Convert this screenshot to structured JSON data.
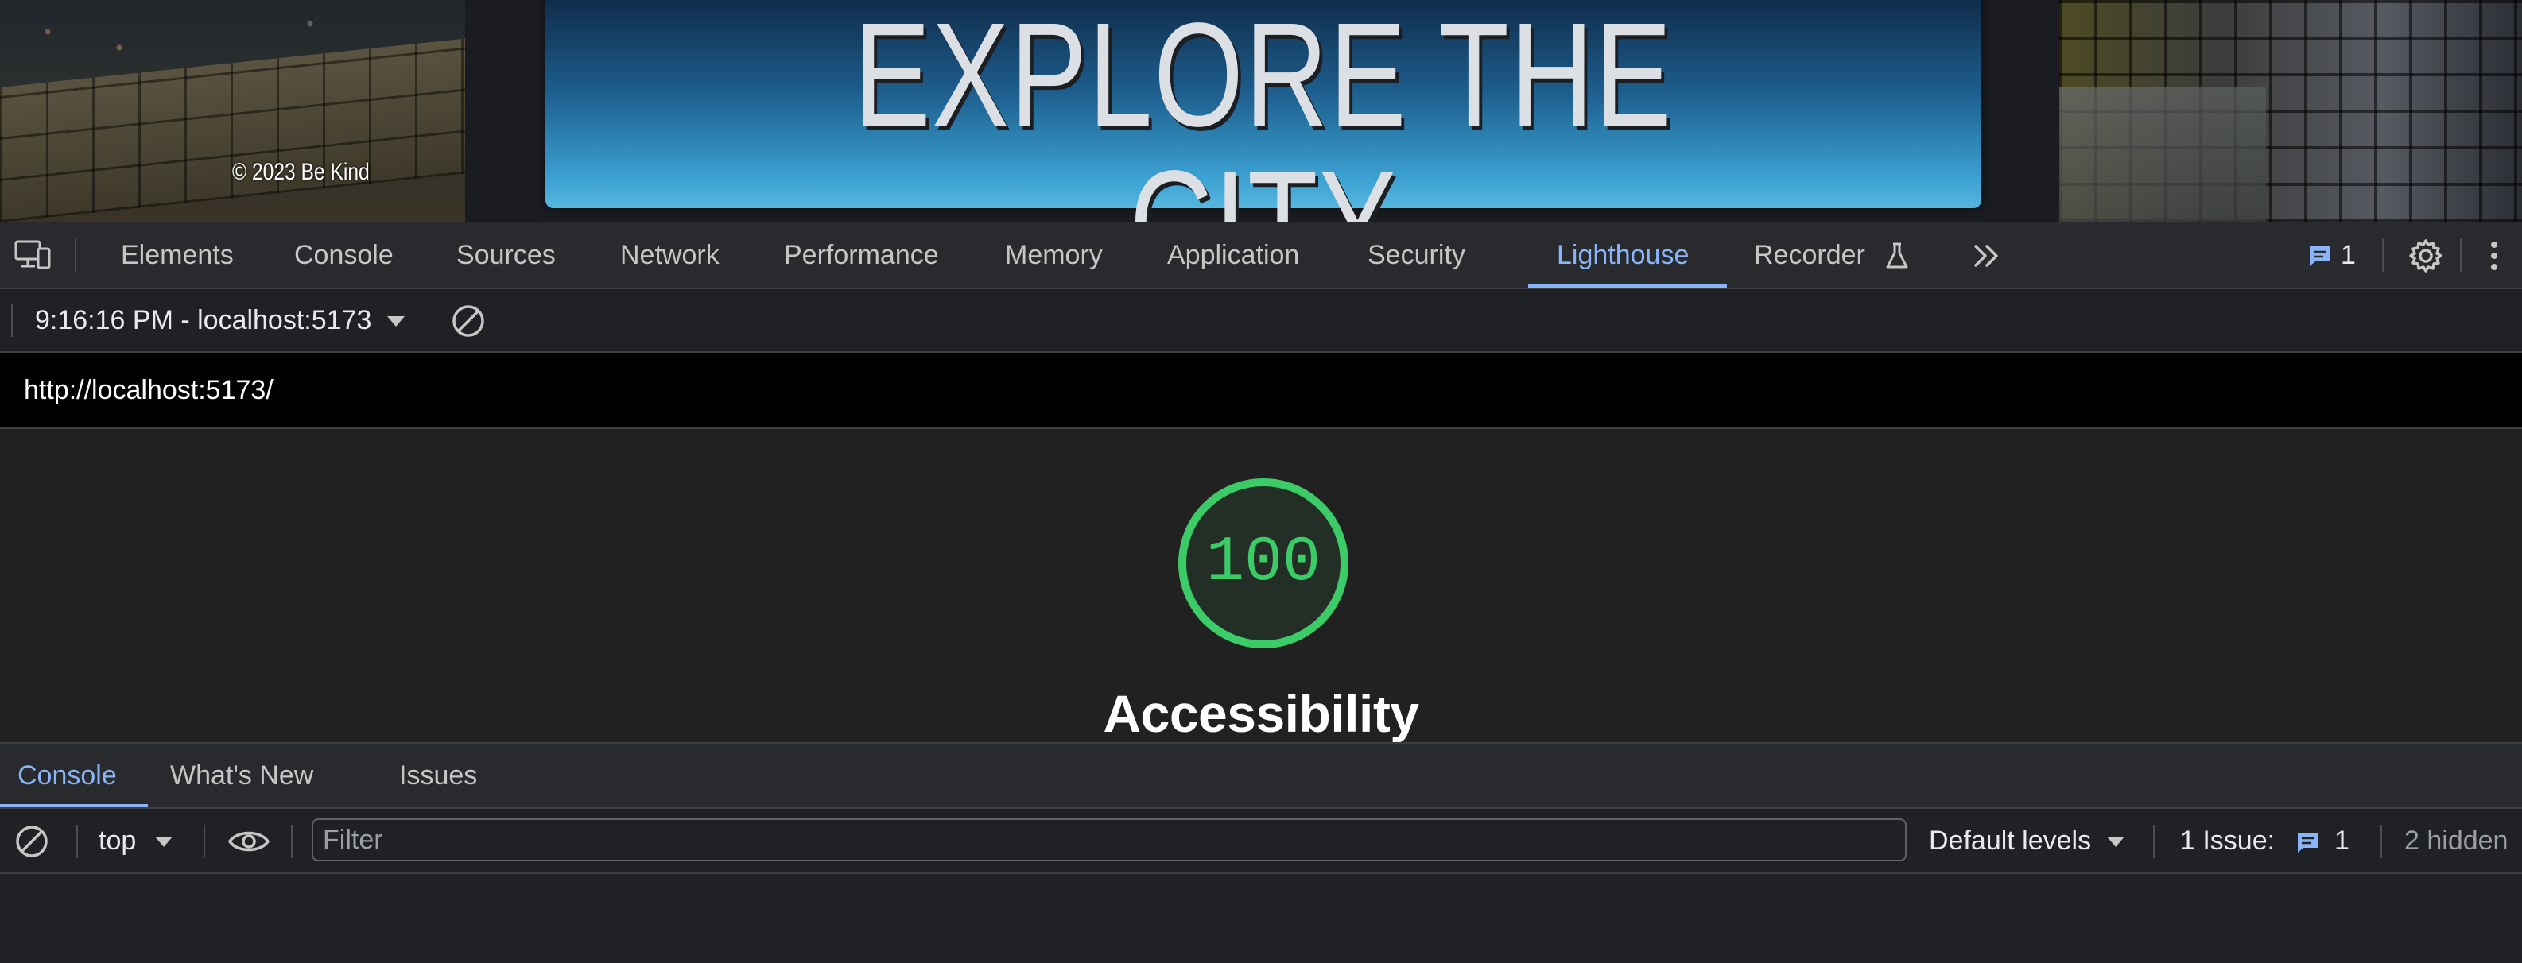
{
  "site": {
    "hero_title": "EXPLORE THE CITY",
    "copyright": "© 2023 Be Kind"
  },
  "devtools": {
    "tabs": [
      {
        "label": "Elements"
      },
      {
        "label": "Console"
      },
      {
        "label": "Sources"
      },
      {
        "label": "Network"
      },
      {
        "label": "Performance"
      },
      {
        "label": "Memory"
      },
      {
        "label": "Application"
      },
      {
        "label": "Security"
      },
      {
        "label": "Lighthouse",
        "active": true
      },
      {
        "label": "Recorder"
      }
    ],
    "issues_count": "1",
    "icons": {
      "device_toggle": "device-toggle-icon",
      "more_tabs": "chevron-double-right-icon",
      "issues": "message-icon",
      "settings": "gear-icon",
      "menu": "vertical-dots-icon",
      "recorder": "flask-icon"
    },
    "accent_color": "#8ab4f8"
  },
  "report": {
    "selector_label": "9:16:16 PM - localhost:5173",
    "url": "http://localhost:5173/",
    "score": "100",
    "category": "Accessibility",
    "score_color": "#3ccc67"
  },
  "drawer": {
    "tabs": [
      {
        "label": "Console",
        "active": true
      },
      {
        "label": "What's New"
      },
      {
        "label": "Issues"
      }
    ],
    "context": "top",
    "filter_placeholder": "Filter",
    "levels": "Default levels",
    "issues_label": "1 Issue:",
    "issues_count": "1",
    "hidden": "2 hidden"
  }
}
